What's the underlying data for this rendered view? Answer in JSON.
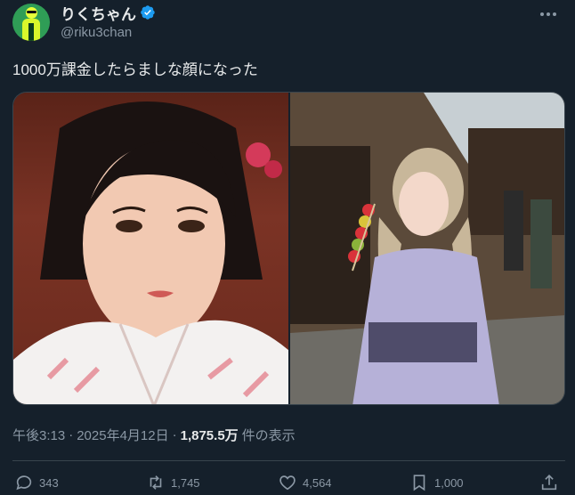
{
  "user": {
    "display_name": "りくちゃん",
    "handle": "@riku3chan",
    "verified": true
  },
  "tweet": {
    "text": "1000万課金したらましな顔になった"
  },
  "meta": {
    "time": "午後3:13",
    "separator": "·",
    "date": "2025年4月12日",
    "views_count": "1,875.5万",
    "views_suffix": "件の表示"
  },
  "actions": {
    "replies": "343",
    "reposts": "1,745",
    "likes": "4,564",
    "bookmarks": "1,000"
  },
  "colors": {
    "background": "#15202b",
    "text": "#e7e9ea",
    "muted": "#8b98a5",
    "verified": "#1d9bf0",
    "divider": "#38444d"
  },
  "icons": {
    "more": "more-horizontal-icon",
    "verified": "verified-badge-icon",
    "reply": "reply-icon",
    "repost": "repost-icon",
    "like": "heart-icon",
    "bookmark": "bookmark-icon",
    "share": "share-icon"
  }
}
